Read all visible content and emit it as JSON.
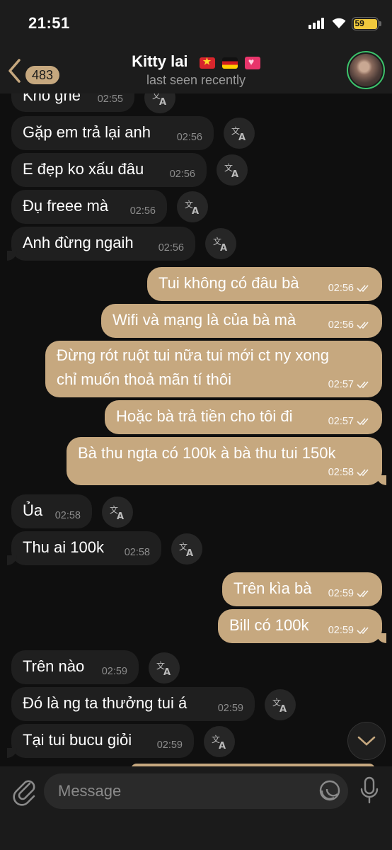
{
  "status_bar": {
    "time": "21:51",
    "battery": "59"
  },
  "header": {
    "back_count": "483",
    "title": "Kitty lai",
    "subtitle": "last seen recently",
    "flags": [
      "vietnam-flag",
      "germany-flag",
      "love-letter-emoji"
    ]
  },
  "messages": [
    {
      "dir": "in",
      "text": "Kho ghe",
      "time": "02:55"
    },
    {
      "dir": "in",
      "text": "Gặp em trả lại anh",
      "time": "02:56"
    },
    {
      "dir": "in",
      "text": "E đẹp ko xấu đâu",
      "time": "02:56"
    },
    {
      "dir": "in",
      "text": "Đụ freee mà",
      "time": "02:56"
    },
    {
      "dir": "in",
      "text": "Anh đừng ngaih",
      "time": "02:56"
    },
    {
      "dir": "out",
      "text": "Tui không có đâu bà",
      "time": "02:56"
    },
    {
      "dir": "out",
      "text": "Wifi và mạng là của bà mà",
      "time": "02:56"
    },
    {
      "dir": "out",
      "line1": "Đừng rót ruột tui nữa tui mới ct ny xong",
      "line2": "chỉ muốn thoả mãn tí thôi",
      "time": "02:57"
    },
    {
      "dir": "out",
      "text": "Hoặc bà trả tiền cho tôi đi",
      "time": "02:57"
    },
    {
      "dir": "out",
      "text": "Bà thu ngta có 100k à bà thu tui 150k",
      "time": "02:58"
    },
    {
      "dir": "in",
      "text": "Ủa",
      "time": "02:58"
    },
    {
      "dir": "in",
      "text": "Thu ai 100k",
      "time": "02:58"
    },
    {
      "dir": "out",
      "text": "Trên kìa bà",
      "time": "02:59"
    },
    {
      "dir": "out",
      "text": "Bill có 100k",
      "time": "02:59"
    },
    {
      "dir": "in",
      "text": "Trên nào",
      "time": "02:59"
    },
    {
      "dir": "in",
      "text": "Đó là ng ta thưởng tui á",
      "time": "02:59"
    },
    {
      "dir": "in",
      "text": "Tại tui bucu giỏi",
      "time": "02:59"
    }
  ],
  "input": {
    "placeholder": "Message"
  },
  "colors": {
    "outgoing_bubble": "#c6a87f",
    "incoming_bubble": "#1f1f1f",
    "background": "#0f0f0f"
  }
}
